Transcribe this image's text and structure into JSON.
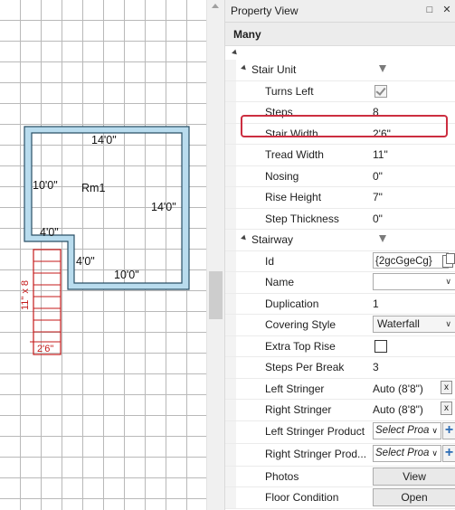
{
  "canvas": {
    "room": {
      "name": "Rm1",
      "dimensions": [
        "14'0\"",
        "10'0\"",
        "14'0\"",
        "4'0\"",
        "4'0\"",
        "10'0\""
      ]
    },
    "stair": {
      "width_label": "2'6\"",
      "steps_label": "11\" x 8"
    }
  },
  "panel": {
    "title": "Property View",
    "pin_icon": "□",
    "close_icon": "✕",
    "selection": "Many",
    "sections": {
      "stair_unit": "Stair Unit",
      "stairway": "Stairway"
    },
    "stair_unit": {
      "turns_left": {
        "label": "Turns Left",
        "checked": true
      },
      "steps": {
        "label": "Steps",
        "value": "8"
      },
      "stair_width": {
        "label": "Stair Width",
        "value": "2'6\""
      },
      "tread_width": {
        "label": "Tread Width",
        "value": "11\""
      },
      "nosing": {
        "label": "Nosing",
        "value": "0\""
      },
      "rise_height": {
        "label": "Rise Height",
        "value": "7\""
      },
      "step_thickness": {
        "label": "Step Thickness",
        "value": "0\""
      }
    },
    "stairway": {
      "id": {
        "label": "Id",
        "value": "{2gcGgeCg}"
      },
      "name": {
        "label": "Name",
        "value": ""
      },
      "duplication": {
        "label": "Duplication",
        "value": "1"
      },
      "covering_style": {
        "label": "Covering Style",
        "value": "Waterfall"
      },
      "extra_top_rise": {
        "label": "Extra Top Rise",
        "checked": false
      },
      "steps_per_break": {
        "label": "Steps Per Break",
        "value": "3"
      },
      "left_stringer": {
        "label": "Left Stringer",
        "value": "Auto (8'8\")",
        "clear": "x"
      },
      "right_stringer": {
        "label": "Right Stringer",
        "value": "Auto (8'8\")",
        "clear": "x"
      },
      "left_stringer_product": {
        "label": "Left Stringer Product",
        "value": "Select Proa"
      },
      "right_stringer_product": {
        "label": "Right Stringer Prod...",
        "value": "Select Proa"
      },
      "photos": {
        "label": "Photos",
        "button": "View"
      },
      "floor_condition": {
        "label": "Floor Condition",
        "button": "Open"
      }
    }
  },
  "colors": {
    "wall_fill": "#b9dcee",
    "wall_stroke": "#2a4f66",
    "stair_color": "#c41a1a",
    "highlight": "#cc2e40",
    "plus_icon": "#2d6db5"
  }
}
